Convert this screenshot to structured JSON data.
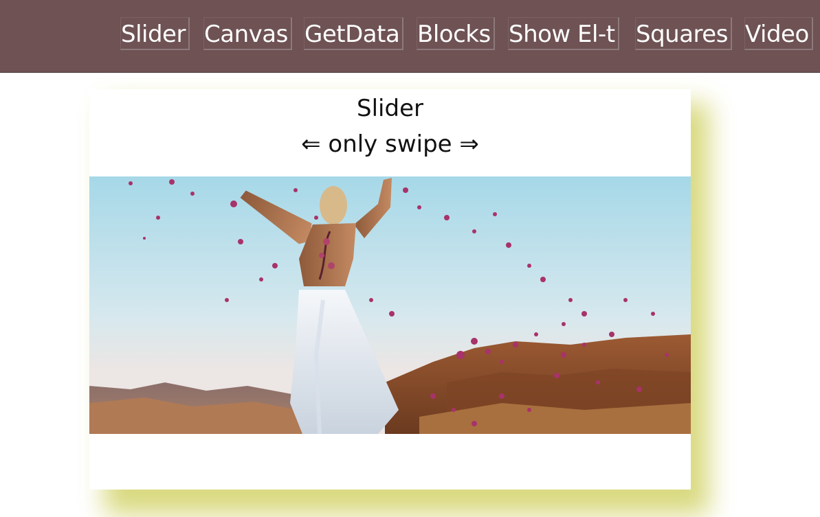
{
  "nav": {
    "items": [
      {
        "label": "Slider"
      },
      {
        "label": "Canvas"
      },
      {
        "label": "GetData"
      },
      {
        "label": "Blocks"
      },
      {
        "label": "Show El-t"
      },
      {
        "label": "Squares"
      },
      {
        "label": "Video"
      }
    ]
  },
  "slider": {
    "title": "Slider",
    "subtitle": "⇐ only swipe ⇒"
  },
  "colors": {
    "topbar": "#6e5254",
    "shadow": "#d2d36a",
    "card": "#ffffff"
  }
}
